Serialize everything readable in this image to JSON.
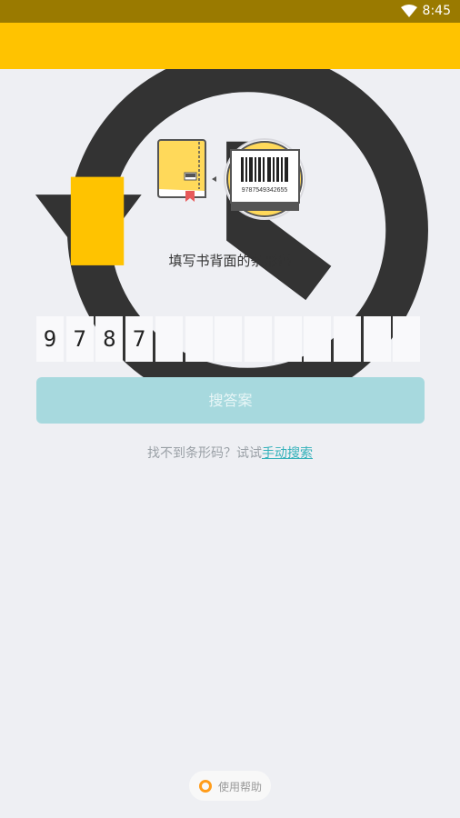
{
  "status_bar": {
    "time": "8:45",
    "icons": [
      "wifi-icon"
    ]
  },
  "app_bar": {
    "history_icon": "history-icon",
    "accent_color": "#ffc300"
  },
  "illustration": {
    "barcode_number": "9787549342655",
    "icons": [
      "book-icon",
      "barcode-icon"
    ]
  },
  "instruction": "填写书背面的条形码",
  "isbn_input": {
    "digits": [
      "9",
      "7",
      "8",
      "7",
      "",
      "",
      "",
      "",
      "",
      "",
      "",
      "",
      ""
    ]
  },
  "search_button": {
    "label": "搜答案",
    "color": "#a7d9de"
  },
  "manual_search": {
    "prefix": "找不到条形码？试试",
    "link": "手动搜索"
  },
  "help": {
    "label": "使用帮助",
    "icon": "lifebuoy-icon"
  }
}
